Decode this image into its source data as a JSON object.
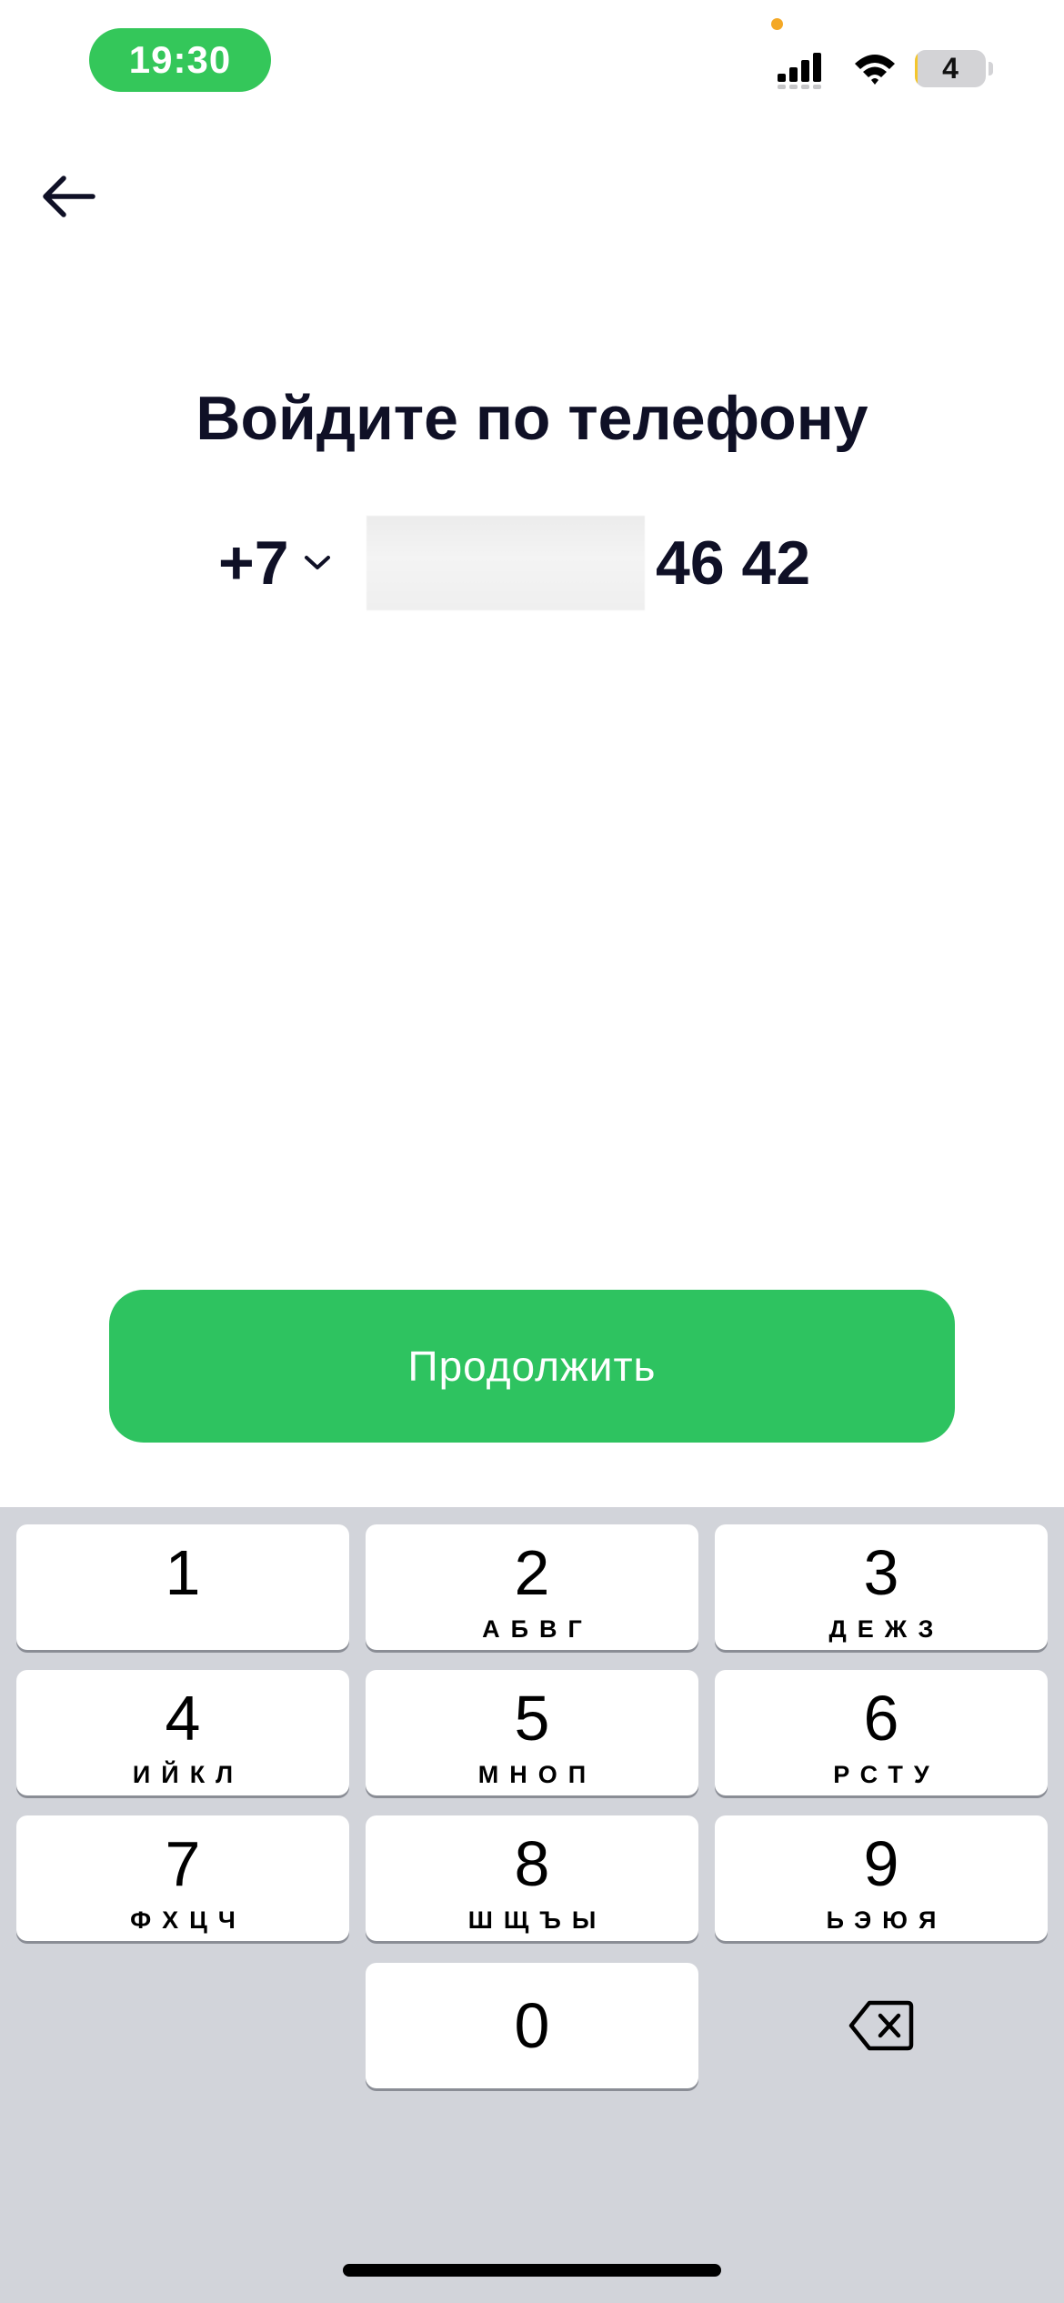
{
  "status_bar": {
    "time": "19:30",
    "battery_level": "4",
    "battery_fraction": 0.04,
    "signal_icon": "cellular-signal-icon",
    "wifi_icon": "wifi-icon",
    "colors": {
      "time_pill": "#34c75a",
      "privacy_dot": "#f4a825",
      "battery_fill": "#f4c62c"
    }
  },
  "header": {
    "back_icon": "arrow-left-icon"
  },
  "main": {
    "title": "Войдите по телефону",
    "country_code": "+7",
    "country_code_icon": "chevron-down-icon",
    "phone_visible_suffix": "46 42"
  },
  "continue_button": {
    "label": "Продолжить",
    "color": "#2ec360"
  },
  "keyboard": {
    "keys": [
      {
        "digit": "1",
        "letters": ""
      },
      {
        "digit": "2",
        "letters": "АБВГ"
      },
      {
        "digit": "3",
        "letters": "ДЕЖЗ"
      },
      {
        "digit": "4",
        "letters": "ИЙКЛ"
      },
      {
        "digit": "5",
        "letters": "МНОП"
      },
      {
        "digit": "6",
        "letters": "РСТУ"
      },
      {
        "digit": "7",
        "letters": "ФХЦЧ"
      },
      {
        "digit": "8",
        "letters": "ШЩЪЫ"
      },
      {
        "digit": "9",
        "letters": "ЬЭЮЯ"
      },
      {
        "digit": "0",
        "letters": ""
      }
    ],
    "delete_icon": "backspace-icon",
    "background": "#d2d4da"
  }
}
